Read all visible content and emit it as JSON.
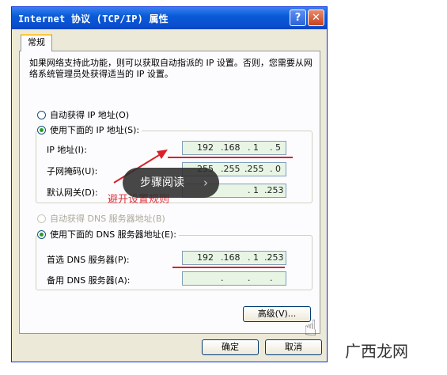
{
  "window": {
    "title": "Internet 协议 (TCP/IP) 属性",
    "help_glyph": "?",
    "close_glyph": "✕"
  },
  "tabs": [
    {
      "label": "常规"
    }
  ],
  "description": "如果网络支持此功能，则可以获取自动指派的 IP 设置。否则，您需要从网络系统管理员处获得适当的 IP 设置。",
  "ip_section": {
    "auto_label": "自动获得 IP 地址(O)",
    "manual_label": "使用下面的 IP 地址(S):",
    "fields": [
      {
        "label": "IP 地址(I):",
        "octets": [
          "192",
          ".168",
          ". 1",
          ". 5"
        ]
      },
      {
        "label": "子网掩码(U):",
        "octets": [
          "255",
          ".255",
          ".255",
          ". 0"
        ]
      },
      {
        "label": "默认网关(D):",
        "octets": [
          "",
          "",
          ". 1",
          ".253"
        ]
      }
    ]
  },
  "dns_section": {
    "auto_label": "自动获得 DNS 服务器地址(B)",
    "manual_label": "使用下面的 DNS 服务器地址(E):",
    "fields": [
      {
        "label": "首选 DNS 服务器(P):",
        "octets": [
          "192",
          ".168",
          ". 1",
          ".253"
        ]
      },
      {
        "label": "备用 DNS 服务器(A):",
        "octets": [
          "",
          ".",
          ".",
          "."
        ]
      }
    ]
  },
  "buttons": {
    "advanced": "高级(V)...",
    "ok": "确定",
    "cancel": "取消"
  },
  "overlay": {
    "label": "步骤阅读",
    "chevron": "›",
    "annotation": "避开设置规则"
  },
  "brand": "广西龙网",
  "colors": {
    "accent_red": "#d8222a",
    "title_blue": "#0a5ad7",
    "field_green": "#e8f5e4",
    "radio_green": "#21a121"
  }
}
